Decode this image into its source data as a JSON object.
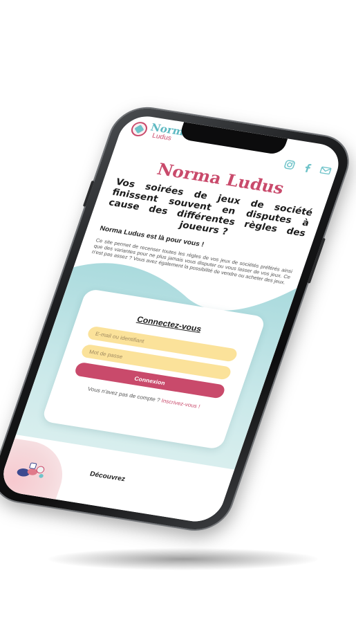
{
  "header": {
    "logo_line1": "Norma",
    "logo_line2": "Ludus",
    "social_icons": [
      "instagram-icon",
      "facebook-icon",
      "mail-icon"
    ]
  },
  "hero": {
    "brand_title": "Norma Ludus",
    "headline": "Vos soirées de jeux de société finissent souvent en disputes à cause des différentes règles des joueurs ?",
    "subhead": "Norma Ludus est là pour vous !",
    "intro": "Ce site permet de recenser toutes les règles de vos jeux de sociétés préférés ainsi que des variantes pour ne plus jamais vous disputer ou vous lasser de vos jeux. Ce n'est pas assez ? Vous avez également la possibilité de vendre ou acheter des jeux."
  },
  "login": {
    "title": "Connectez-vous",
    "email_placeholder": "E-mail ou identifiant",
    "password_placeholder": "Mot de passe",
    "submit_label": "Connexion",
    "no_account_text": "Vous n'avez pas de compte ?",
    "signup_link": "Inscrivez-vous !"
  },
  "discover": {
    "label": "Découvrez"
  },
  "colors": {
    "brand_pink": "#c94a6b",
    "brand_teal": "#6fc3c9",
    "field_yellow": "#fbe29a",
    "wave_teal": "#cde9eb"
  }
}
